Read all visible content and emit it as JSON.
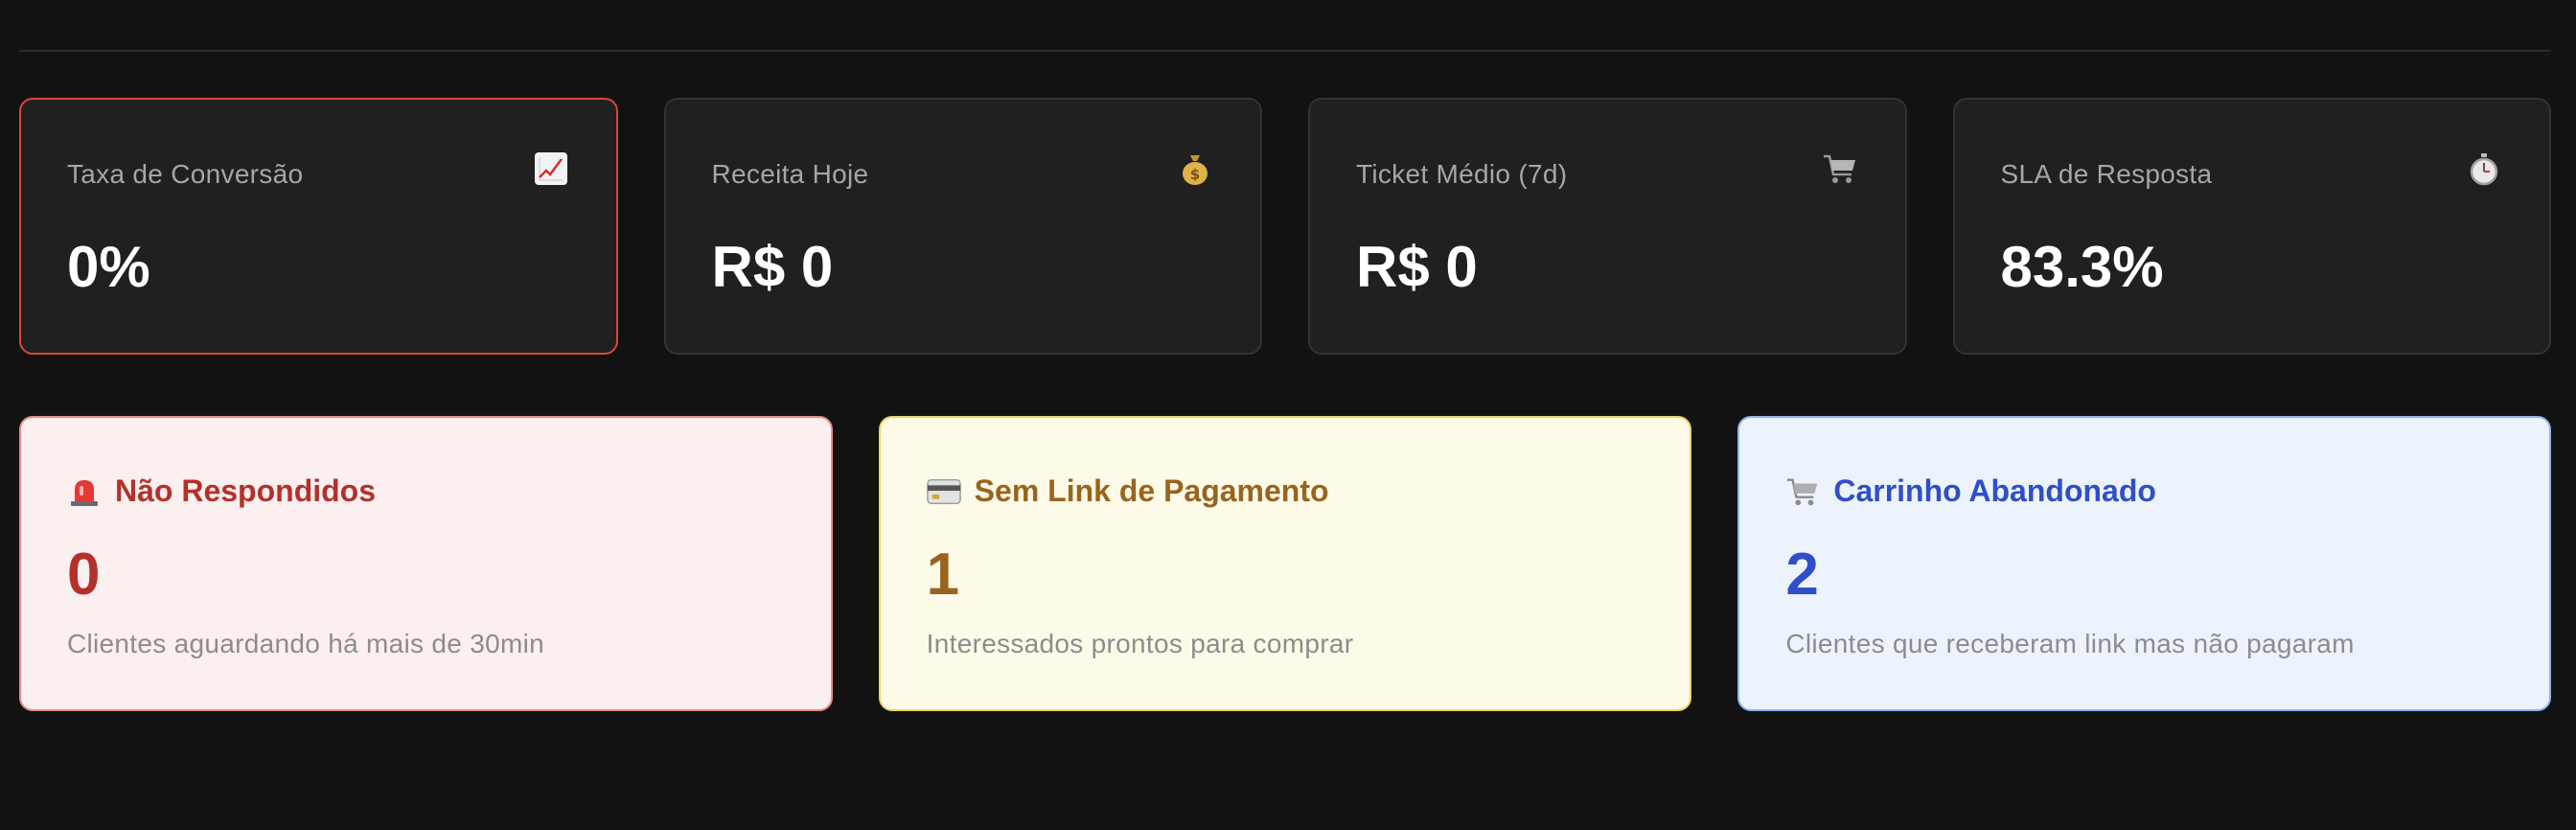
{
  "kpis": [
    {
      "label": "Taxa de Conversão",
      "value": "0%",
      "icon": "chart-up-icon"
    },
    {
      "label": "Receita Hoje",
      "value": "R$ 0",
      "icon": "money-bag-icon"
    },
    {
      "label": "Ticket Médio (7d)",
      "value": "R$ 0",
      "icon": "cart-icon"
    },
    {
      "label": "SLA de Resposta",
      "value": "83.3%",
      "icon": "stopwatch-icon"
    }
  ],
  "alerts": [
    {
      "title": "Não Respondidos",
      "value": "0",
      "description": "Clientes aguardando há mais de 30min",
      "icon": "siren-icon",
      "color": "#b3312b"
    },
    {
      "title": "Sem Link de Pagamento",
      "value": "1",
      "description": "Interessados prontos para comprar",
      "icon": "credit-card-icon",
      "color": "#99641f"
    },
    {
      "title": "Carrinho Abandonado",
      "value": "2",
      "description": "Clientes que receberam link mas não pagaram",
      "icon": "cart-icon",
      "color": "#2f4fc9"
    }
  ],
  "colors": {
    "background": "#121212",
    "card": "#202020",
    "highlight_border": "#d9483b"
  }
}
